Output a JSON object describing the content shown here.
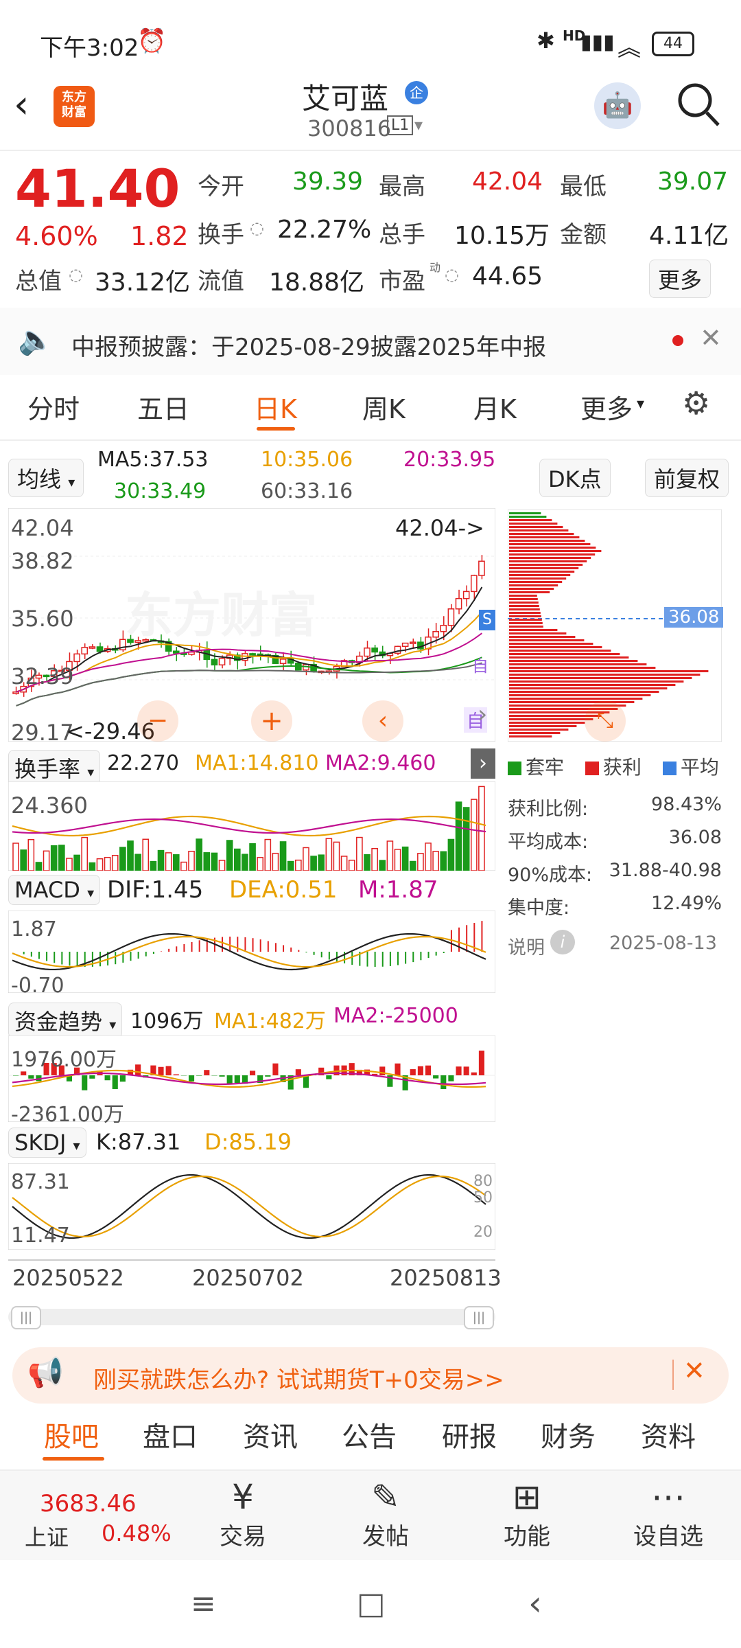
{
  "status": {
    "time": "下午3:02",
    "battery": "44",
    "network": "HD"
  },
  "header": {
    "app_logo": "东方\n财富",
    "stock_name": "艾可蓝",
    "badge": "企",
    "code": "300816",
    "level": "L1"
  },
  "quote": {
    "price": "41.40",
    "pct": "4.60%",
    "change": "1.82",
    "open_label": "今开",
    "open": "39.39",
    "high_label": "最高",
    "high": "42.04",
    "low_label": "最低",
    "low": "39.07",
    "turnover_label": "换手",
    "turnover": "22.27%",
    "volume_label": "总手",
    "volume": "10.15万",
    "amount_label": "金额",
    "amount": "4.11亿",
    "mktcap_label": "总值",
    "mktcap": "33.12亿",
    "float_label": "流值",
    "float": "18.88亿",
    "pe_label": "市盈",
    "pe_sup": "动",
    "pe": "44.65",
    "more": "更多"
  },
  "notice": {
    "text": "中报预披露：于2025-08-29披露2025年中报"
  },
  "tabs": [
    "分时",
    "五日",
    "日K",
    "周K",
    "月K",
    "更多"
  ],
  "active_tab": "日K",
  "ma": {
    "selector": "均线",
    "ma5": "MA5:37.53",
    "ma10": "10:35.06",
    "ma20": "20:33.95",
    "ma30": "30:33.49",
    "ma60": "60:33.16",
    "dk": "DK点",
    "fq": "前复权"
  },
  "kline": {
    "y_labels": [
      "42.04",
      "38.82",
      "35.60",
      "32.39",
      "29.17"
    ],
    "max_note": "42.04->",
    "min_note": "<-29.46",
    "watermark": "东方财富",
    "cost_tag": "36.08",
    "badge_s": "S",
    "badge_zi": "自",
    "badge_zi2": "自"
  },
  "chip": {
    "legend": [
      "套牢",
      "获利",
      "平均"
    ],
    "rows": [
      {
        "label": "获利比例:",
        "value": "98.43%"
      },
      {
        "label": "平均成本:",
        "value": "36.08"
      },
      {
        "label": "90%成本:",
        "value": "31.88-40.98"
      },
      {
        "label": "集中度:",
        "value": "12.49%"
      }
    ],
    "note_label": "说明",
    "date": "2025-08-13"
  },
  "turnover_panel": {
    "selector": "换手率",
    "v": "22.270",
    "ma1": "MA1:14.810",
    "ma2": "MA2:9.460",
    "ymax": "24.360"
  },
  "macd_panel": {
    "selector": "MACD",
    "dif": "DIF:1.45",
    "dea": "DEA:0.51",
    "m": "M:1.87",
    "ymax": "1.87",
    "ymin": "-0.70"
  },
  "fund_panel": {
    "selector": "资金趋势",
    "v": "1096万",
    "ma1": "MA1:482万",
    "ma2": "MA2:-25000",
    "ymax": "1976.00万",
    "ymin": "-2361.00万"
  },
  "skdj_panel": {
    "selector": "SKDJ",
    "k": "K:87.31",
    "d": "D:85.19",
    "ymax": "87.31",
    "ymin": "11.47",
    "levels": [
      "80",
      "50",
      "20"
    ]
  },
  "dates": [
    "20250522",
    "20250702",
    "20250813"
  ],
  "ad": {
    "text": "刚买就跌怎么办? 试试期货T+0交易>>"
  },
  "bottom_tabs": [
    "股吧",
    "盘口",
    "资讯",
    "公告",
    "研报",
    "财务",
    "资料"
  ],
  "index": {
    "value": "3683.46",
    "name": "上证",
    "pct": "0.48%"
  },
  "nav": [
    "交易",
    "发帖",
    "功能",
    "设自选"
  ],
  "colors": {
    "up": "#e02020",
    "down": "#1a9a1a",
    "accent": "#f06010",
    "blue": "#3a80e0"
  }
}
